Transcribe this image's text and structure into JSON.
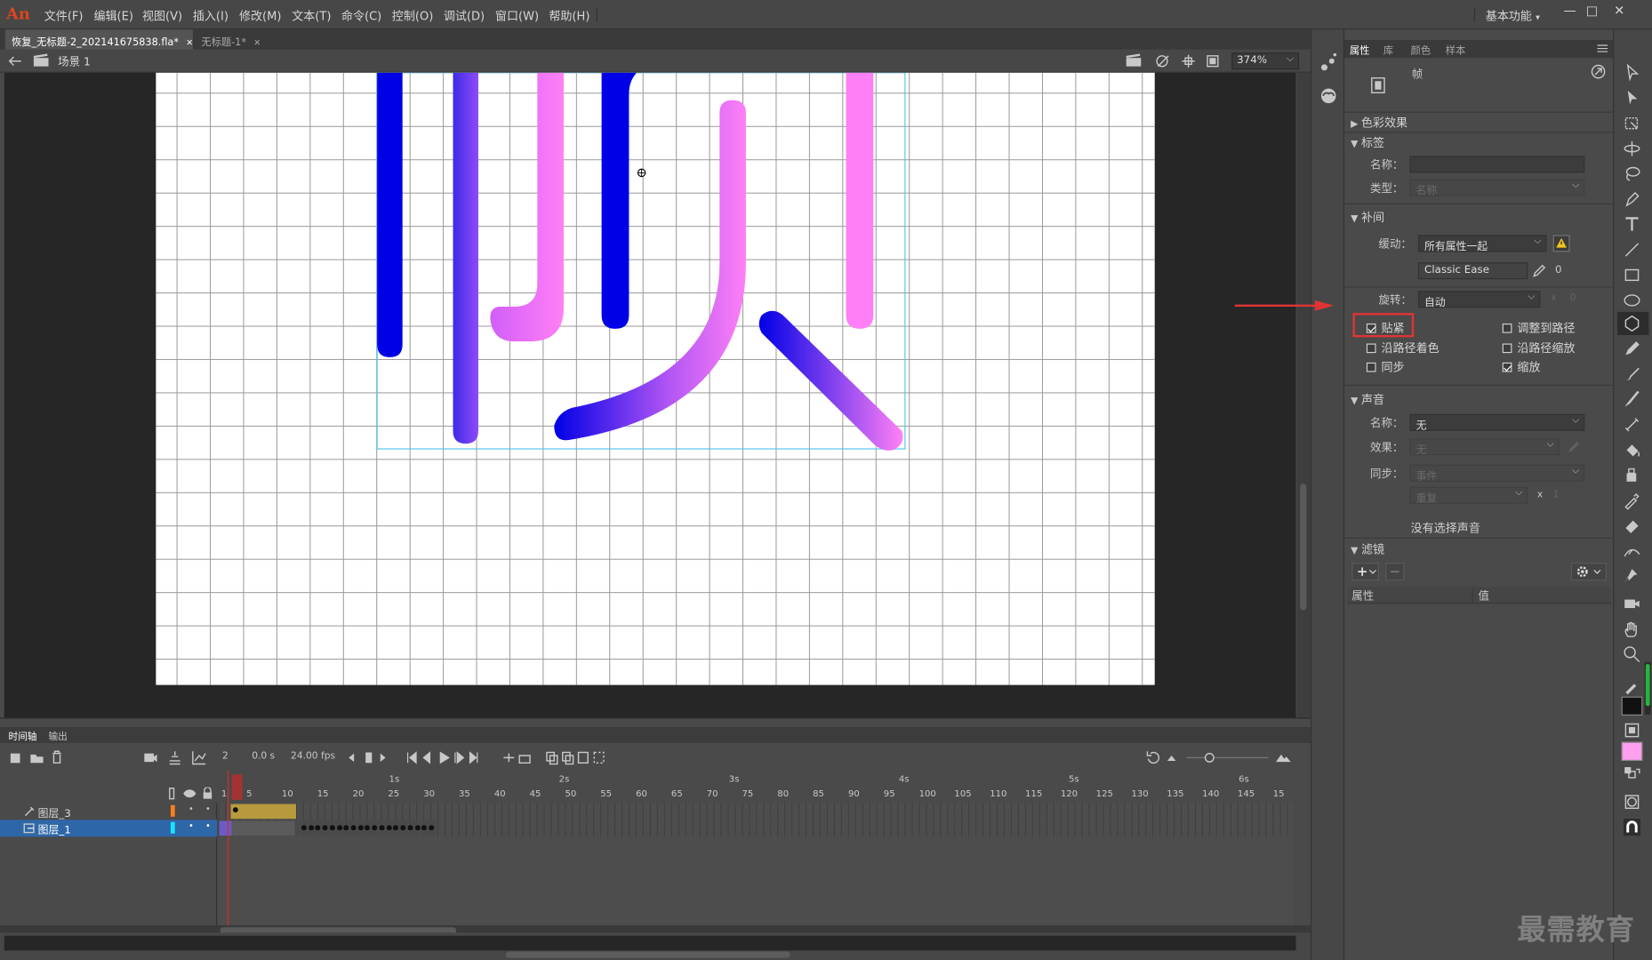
{
  "app": {
    "logo": "An"
  },
  "menubar": {
    "items": [
      "文件(F)",
      "编辑(E)",
      "视图(V)",
      "插入(I)",
      "修改(M)",
      "文本(T)",
      "命令(C)",
      "控制(O)",
      "调试(D)",
      "窗口(W)",
      "帮助(H)"
    ],
    "workspace": "基本功能",
    "workspace_chevron": "▾",
    "minimize": "—",
    "maximize": "□",
    "close": "✕"
  },
  "tabs": [
    {
      "label": "恢复_无标题-2_202141675838.fla*",
      "close": "✕",
      "active": true
    },
    {
      "label": "无标题-1*",
      "close": "✕",
      "active": false
    }
  ],
  "editbar": {
    "scene": "场景 1",
    "zoom": "374%"
  },
  "timeline": {
    "tab_timeline": "时间轴",
    "tab_output": "输出",
    "current_frame": "2",
    "time": "0.0 s",
    "fps": "24.00 fps",
    "frame_numbers": [
      "1",
      "5",
      "10",
      "15",
      "20",
      "25",
      "30",
      "35",
      "40",
      "45",
      "50",
      "55",
      "60",
      "65",
      "70",
      "75",
      "80",
      "85",
      "90",
      "95",
      "100",
      "105",
      "110",
      "115",
      "120",
      "125",
      "130",
      "135",
      "140",
      "145",
      "15"
    ],
    "seconds": [
      "1s",
      "2s",
      "3s",
      "4s",
      "5s",
      "6s"
    ],
    "layers": [
      {
        "name": "图层_3",
        "color": "#ff7f1e",
        "selected": false
      },
      {
        "name": "图层_1",
        "color": "#19e3ff",
        "selected": true
      }
    ]
  },
  "properties": {
    "tabs": [
      "属性",
      "库",
      "颜色",
      "样本"
    ],
    "frame_label": "帧",
    "sections": {
      "color_effect": "色彩效果",
      "label": "标签",
      "tween": "补间",
      "sound": "声音",
      "filters": "滤镜"
    },
    "label_name": "名称：",
    "label_type": "类型：",
    "label_type_value": "名称",
    "ease_label": "缓动：",
    "ease_value": "所有属性一起",
    "ease_preset": "Classic Ease",
    "ease_amount": "0",
    "rotate_label": "旋转：",
    "rotate_value": "自动",
    "rotate_x": "x",
    "rotate_count": "0",
    "checkboxes": [
      {
        "label": "贴紧",
        "checked": true
      },
      {
        "label": "调整到路径",
        "checked": false
      },
      {
        "label": "沿路径着色",
        "checked": false
      },
      {
        "label": "沿路径缩放",
        "checked": false
      },
      {
        "label": "同步",
        "checked": false
      },
      {
        "label": "缩放",
        "checked": true
      }
    ],
    "sound_name_label": "名称：",
    "sound_name_value": "无",
    "sound_effect_label": "效果：",
    "sound_effect_value": "无",
    "sound_sync_label": "同步：",
    "sound_sync_value": "事件",
    "sound_repeat_value": "重复",
    "sound_repeat_x": "x",
    "sound_repeat_count": "1",
    "no_sound": "没有选择声音",
    "filter_col_property": "属性",
    "filter_col_value": "值"
  },
  "colors": {
    "blue": "#0000e6",
    "pink": "#ff7ef5",
    "stroke_swatch": "#111111",
    "fill_swatch": "#ff9ff0",
    "tween_frames": "#b79a3d"
  },
  "watermark": "最需教育"
}
